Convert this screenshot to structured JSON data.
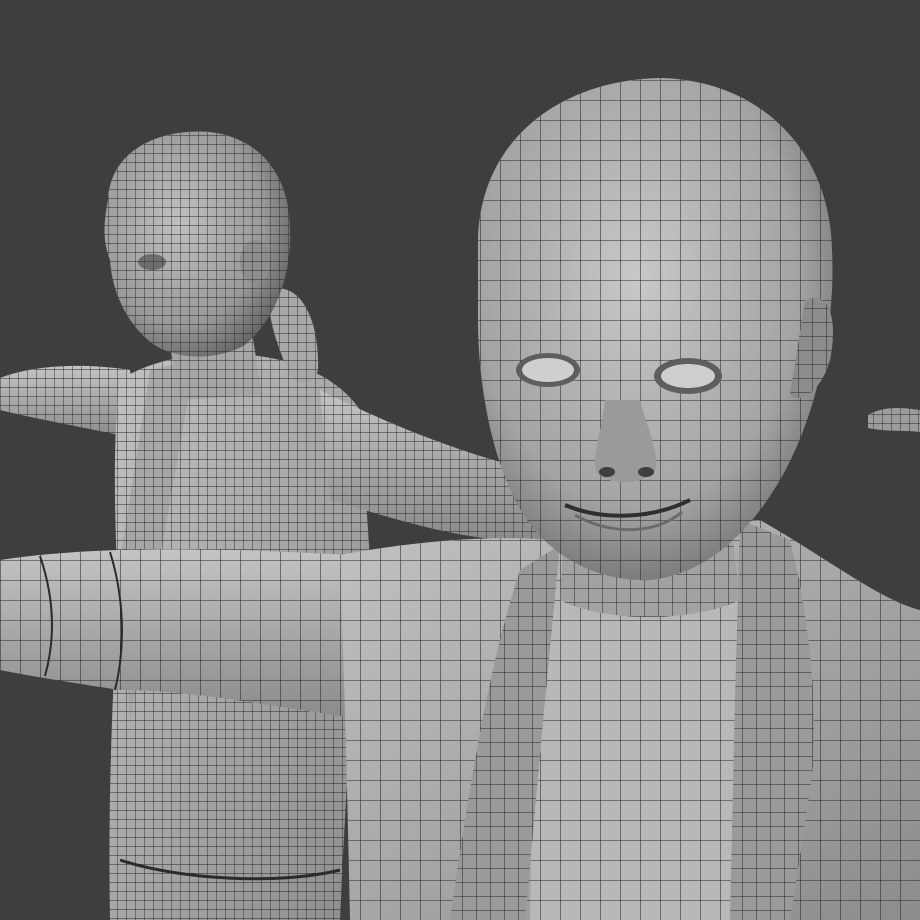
{
  "scene": {
    "description_hidden": "",
    "background_color": "#3e3e3e",
    "mesh_fill_color": "#a9a9a9",
    "mesh_light_color": "#c4c4c4",
    "mesh_shadow_color": "#6e6e6e",
    "wire_color": "#232323",
    "figures": [
      {
        "name": "back-figure-character",
        "pose": "t-pose",
        "view": "three-quarter"
      },
      {
        "name": "front-figure-character",
        "pose": "t-pose",
        "view": "front"
      }
    ]
  }
}
